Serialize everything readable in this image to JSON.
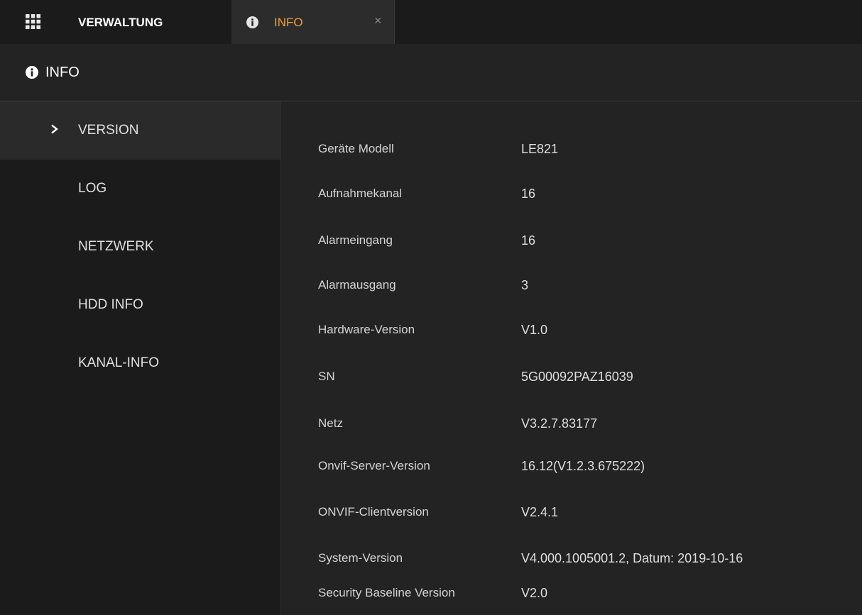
{
  "topbar": {
    "title": "VERWALTUNG",
    "active_tab": {
      "label": "INFO",
      "close_glyph": "×"
    }
  },
  "header": {
    "title": "INFO"
  },
  "sidebar": {
    "items": [
      {
        "label": "VERSION",
        "active": true
      },
      {
        "label": "LOG",
        "active": false
      },
      {
        "label": "NETZWERK",
        "active": false
      },
      {
        "label": "HDD INFO",
        "active": false
      },
      {
        "label": "KANAL-INFO",
        "active": false
      }
    ]
  },
  "version_info": {
    "rows": [
      {
        "key": "Geräte Modell",
        "value": "LE821"
      },
      {
        "key": "Aufnahmekanal",
        "value": "16"
      },
      {
        "key": "Alarmeingang",
        "value": "16"
      },
      {
        "key": "Alarmausgang",
        "value": "3"
      },
      {
        "key": "Hardware-Version",
        "value": "V1.0"
      },
      {
        "key": "SN",
        "value": "5G00092PAZ16039"
      },
      {
        "key": "Netz",
        "value": "V3.2.7.83177"
      },
      {
        "key": "Onvif-Server-Version",
        "value": "16.12(V1.2.3.675222)"
      },
      {
        "key": "ONVIF-Clientversion",
        "value": "V2.4.1"
      },
      {
        "key": "System-Version",
        "value": "V4.000.1005001.2, Datum: 2019-10-16"
      },
      {
        "key": "Security Baseline Version",
        "value": "V2.0"
      }
    ]
  },
  "colors": {
    "accent": "#f0a030",
    "background": "#1f1f1f",
    "sidebar": "#1b1b1b",
    "content": "#232323"
  },
  "icons": {
    "menu": "grid-icon",
    "info": "info-circle-icon",
    "close": "close-icon",
    "active_item": "chevron-right-icon"
  }
}
